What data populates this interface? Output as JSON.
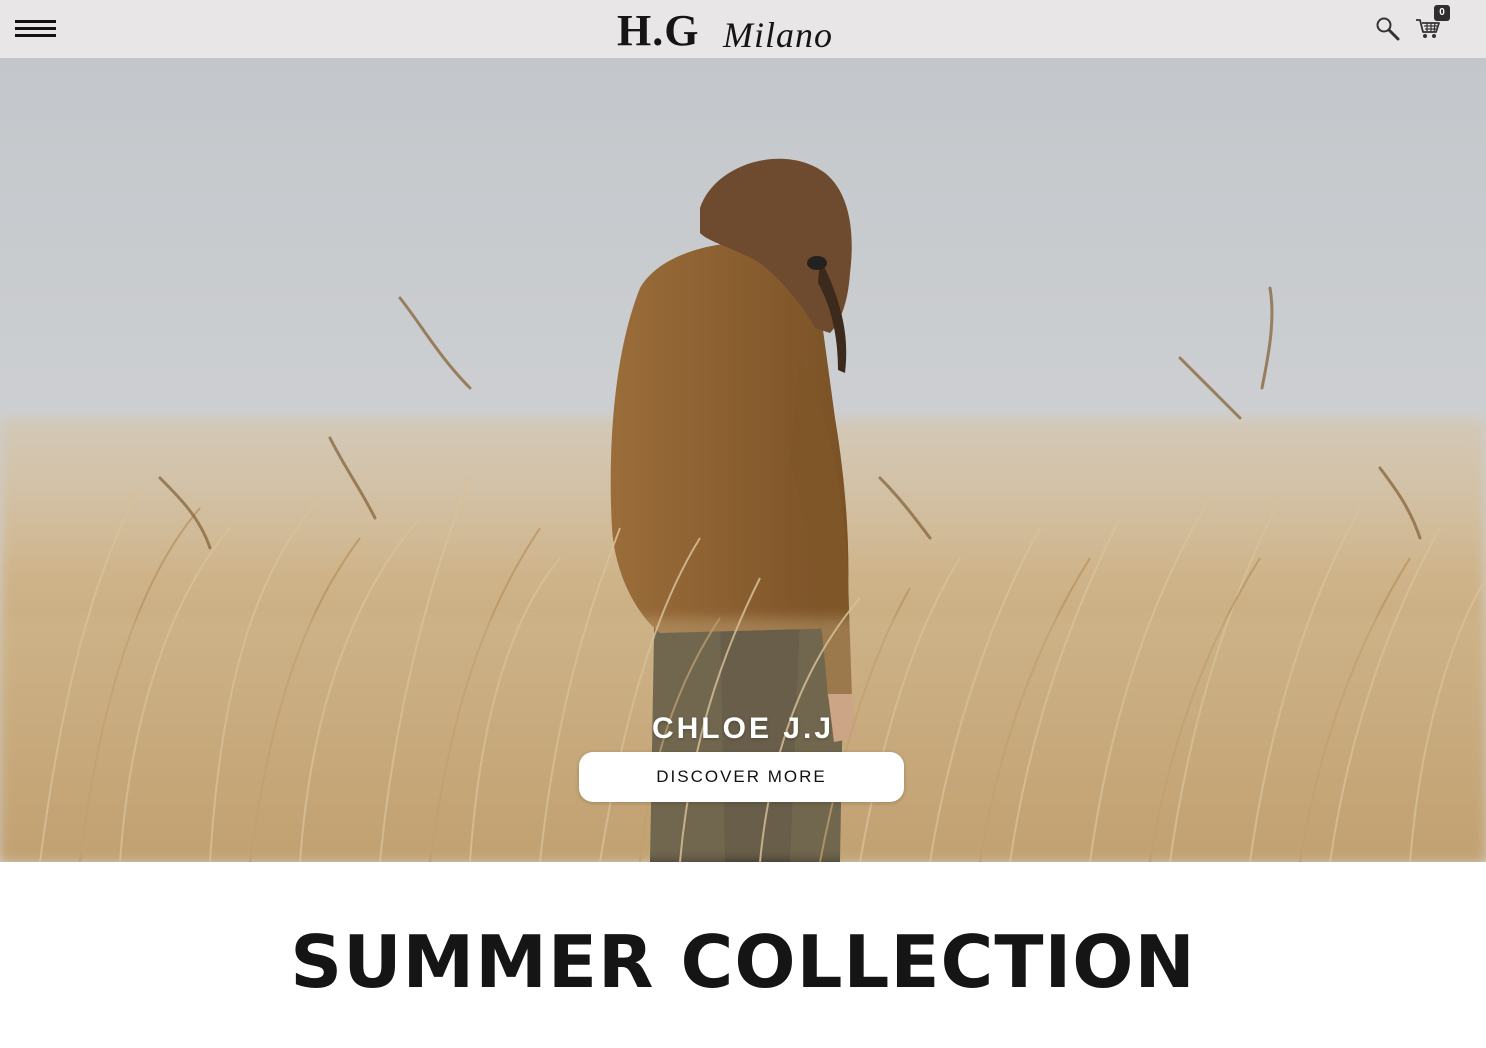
{
  "header": {
    "logo_main": "H.G",
    "logo_script": "Milano",
    "cart_count": "0",
    "icons": {
      "menu": "hamburger-menu-icon",
      "search": "search-icon",
      "cart": "shopping-cart-icon"
    },
    "background": "#e9e6e7"
  },
  "hero": {
    "title": "CHLOE J.J",
    "button_label": "DISCOVER MORE",
    "image_description_colors": {
      "sky": "#c6cacd",
      "grass": "#c9a677",
      "sweater": "#8a6233"
    }
  },
  "section": {
    "title": "SUMMER COLLECTION"
  }
}
